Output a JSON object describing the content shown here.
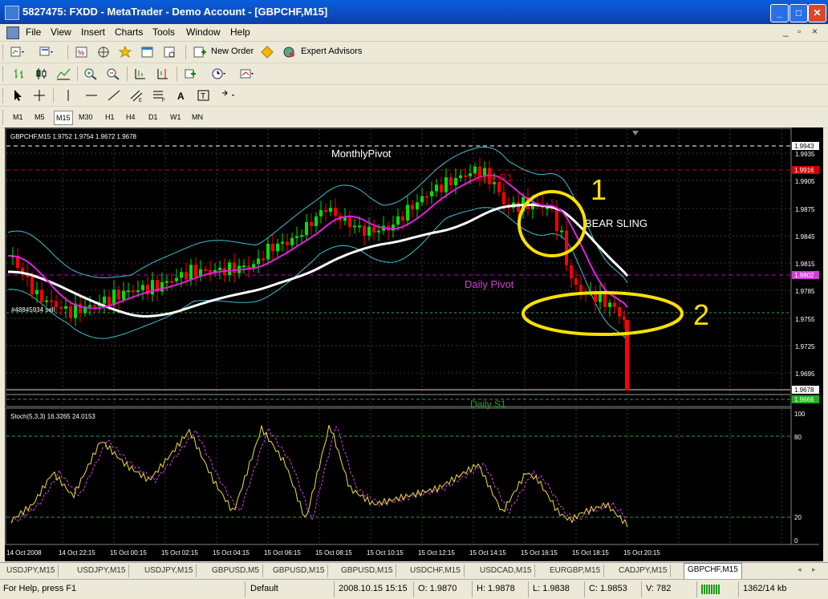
{
  "window": {
    "title": "5827475: FXDD - MetaTrader - Demo Account - [GBPCHF,M15]"
  },
  "menu": [
    "File",
    "View",
    "Insert",
    "Charts",
    "Tools",
    "Window",
    "Help"
  ],
  "toolbar": {
    "new_order": "New Order",
    "expert_advisors": "Expert Advisors"
  },
  "timeframes": [
    "M1",
    "M5",
    "M15",
    "M30",
    "H1",
    "H4",
    "D1",
    "W1",
    "MN"
  ],
  "active_timeframe": "M15",
  "chart": {
    "header": "GBPCHF,M15  1.9752 1.9754 1.9672 1.9678",
    "monthly_pivot": "MonthlyPivot",
    "daily_r1": "Daily R1",
    "daily_pivot": "Daily Pivot",
    "daily_s1": "Daily S1",
    "left_label": "#48845934 sell",
    "annotation_1": "1",
    "annotation_2": "2",
    "bear_sling": "BEAR SLING",
    "price_ticks": [
      "1.9935",
      "1.9905",
      "1.9875",
      "1.9845",
      "1.9815",
      "1.9785",
      "1.9755",
      "1.9725",
      "1.9695"
    ],
    "price_labels": {
      "top": "1.9943",
      "r1": "1.9916",
      "pivot": "1.9802",
      "current": "1.9678",
      "s1": "1.9666"
    },
    "indicator_header": "Stoch(5,3,3) 16.3265 24.0153",
    "stoch_ticks": [
      "100",
      "80",
      "20",
      "0"
    ],
    "time_labels": [
      "14 Oct 2008",
      "14 Oct 22:15",
      "15 Oct 00:15",
      "15 Oct 02:15",
      "15 Oct 04:15",
      "15 Oct 06:15",
      "15 Oct 08:15",
      "15 Oct 10:15",
      "15 Oct 12:15",
      "15 Oct 14:15",
      "15 Oct 16:15",
      "15 Oct 18:15",
      "15 Oct 20:15"
    ],
    "colors": {
      "bull": "#00E000",
      "bear": "#FF0000",
      "magenta": "#E020E0",
      "white_ma": "#FFFFFF",
      "bands": "#40C0D0",
      "annotation": "#FFFF00",
      "r1_line": "#C00000",
      "pivot_line": "#C000C0"
    }
  },
  "tabs": [
    "USDJPY,M15",
    "USDJPY,M15",
    "USDJPY,M15",
    "GBPUSD,M5",
    "GBPUSD,M15",
    "GBPUSD,M15",
    "USDCHF,M15",
    "USDCAD,M15",
    "EURGBP,M15",
    "CADJPY,M15",
    "GBPCHF,M15"
  ],
  "active_tab": "GBPCHF,M15",
  "status": {
    "help": "For Help, press F1",
    "profile": "Default",
    "datetime": "2008.10.15 15:15",
    "open": "O: 1.9870",
    "high": "H: 1.9878",
    "low": "L: 1.9838",
    "close": "C: 1.9853",
    "volume": "V: 782",
    "traffic": "1362/14 kb"
  }
}
